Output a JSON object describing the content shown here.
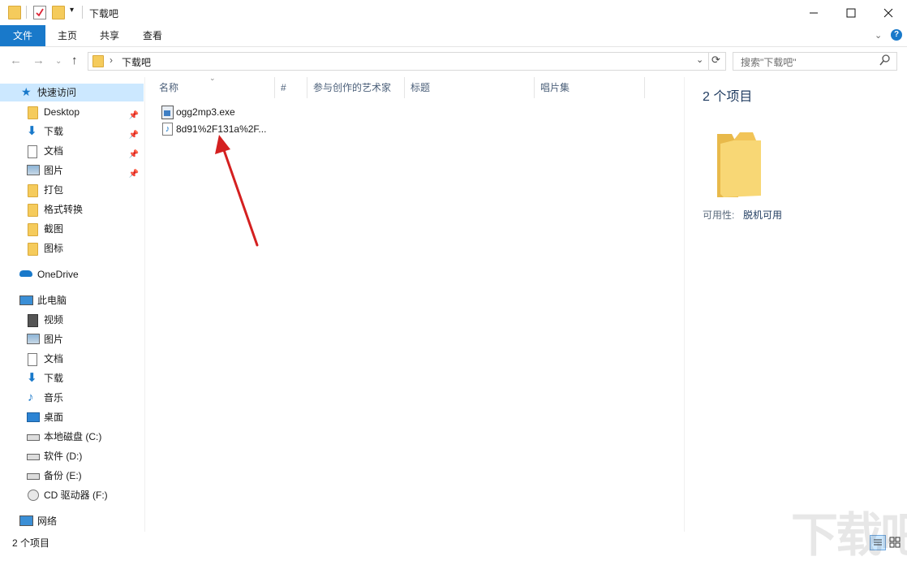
{
  "window": {
    "title": "下载吧"
  },
  "ribbon": {
    "tabs": [
      "文件",
      "主页",
      "共享",
      "查看"
    ]
  },
  "address": {
    "path": "下载吧",
    "search_placeholder": "搜索\"下载吧\""
  },
  "sidebar": {
    "quick_access": "快速访问",
    "quick_items": [
      "Desktop",
      "下载",
      "文档",
      "图片",
      "打包",
      "格式转换",
      "截图",
      "图标"
    ],
    "onedrive": "OneDrive",
    "this_pc": "此电脑",
    "pc_items": [
      "视频",
      "图片",
      "文档",
      "下载",
      "音乐",
      "桌面",
      "本地磁盘 (C:)",
      "软件 (D:)",
      "备份 (E:)",
      "CD 驱动器 (F:)"
    ],
    "network": "网络"
  },
  "columns": [
    "名称",
    "#",
    "参与创作的艺术家",
    "标题",
    "唱片集"
  ],
  "files": [
    {
      "name": "ogg2mp3.exe",
      "icon": "exe-icon"
    },
    {
      "name": "8d91%2F131a%2F...",
      "icon": "audio-file-icon"
    }
  ],
  "detail": {
    "count": "2 个项目",
    "availability_label": "可用性:",
    "availability_value": "脱机可用"
  },
  "status": {
    "count": "2 个项目"
  },
  "colors": {
    "accent": "#1979ca",
    "selection": "#cce8ff",
    "folder": "#f5cb5c",
    "arrow": "#d42020"
  },
  "watermark": "下载吧"
}
